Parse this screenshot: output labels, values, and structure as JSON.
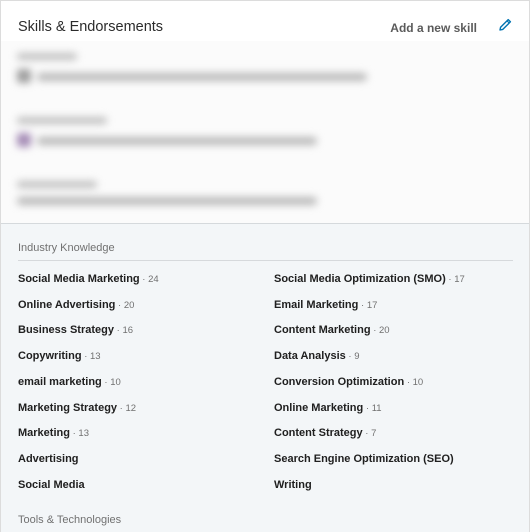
{
  "header": {
    "title": "Skills & Endorsements",
    "add_skill_label": "Add a new skill",
    "edit_icon": "pencil-icon"
  },
  "colors": {
    "accent": "#0073b1",
    "section_bg": "#f3f6f8"
  },
  "categories": [
    {
      "label": "Industry Knowledge",
      "skills": [
        {
          "name": "Social Media Marketing",
          "count": "24"
        },
        {
          "name": "Social Media Optimization (SMO)",
          "count": "17"
        },
        {
          "name": "Online Advertising",
          "count": "20"
        },
        {
          "name": "Email Marketing",
          "count": "17"
        },
        {
          "name": "Business Strategy",
          "count": "16"
        },
        {
          "name": "Content Marketing",
          "count": "20"
        },
        {
          "name": "Copywriting",
          "count": "13"
        },
        {
          "name": "Data Analysis",
          "count": "9"
        },
        {
          "name": "email marketing",
          "count": "10"
        },
        {
          "name": "Conversion Optimization",
          "count": "10"
        },
        {
          "name": "Marketing Strategy",
          "count": "12"
        },
        {
          "name": "Online Marketing",
          "count": "11"
        },
        {
          "name": "Marketing",
          "count": "13"
        },
        {
          "name": "Content Strategy",
          "count": "7"
        },
        {
          "name": "Advertising",
          "count": ""
        },
        {
          "name": "Search Engine Optimization (SEO)",
          "count": ""
        },
        {
          "name": "Social Media",
          "count": ""
        },
        {
          "name": "Writing",
          "count": ""
        }
      ]
    },
    {
      "label": "Tools & Technologies",
      "skills": []
    }
  ]
}
